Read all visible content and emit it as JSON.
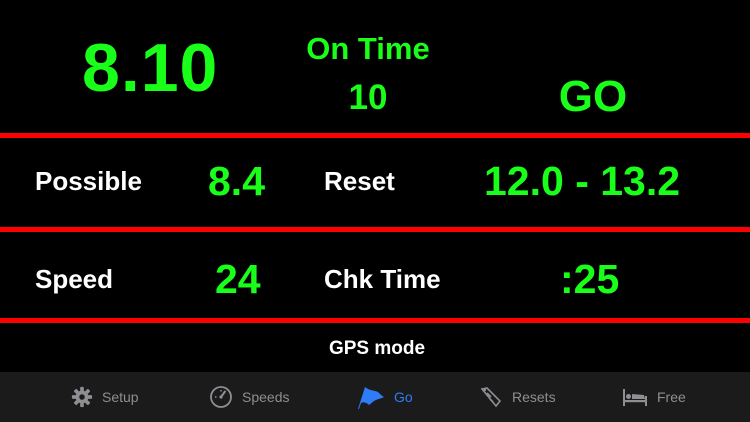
{
  "top": {
    "distance": "8.10",
    "on_time_label": "On Time",
    "on_time_value": "10",
    "status": "GO"
  },
  "rows": {
    "possible_label": "Possible",
    "possible_value": "8.4",
    "reset_label": "Reset",
    "reset_value": "12.0 - 13.2",
    "speed_label": "Speed",
    "speed_value": "24",
    "chk_time_label": "Chk Time",
    "chk_time_value": ":25"
  },
  "mode_text": "GPS mode",
  "tabs": [
    {
      "label": "Setup",
      "icon": "gear-icon",
      "active": false
    },
    {
      "label": "Speeds",
      "icon": "speedometer-icon",
      "active": false
    },
    {
      "label": "Go",
      "icon": "flag-icon",
      "active": true
    },
    {
      "label": "Resets",
      "icon": "resets-icon",
      "active": false
    },
    {
      "label": "Free",
      "icon": "bed-icon",
      "active": false
    }
  ],
  "colors": {
    "background": "#000000",
    "value_green": "#19ff19",
    "divider_red": "#ff0000",
    "tab_inactive": "#8e8e93",
    "tab_active": "#2f7cf6",
    "tabbar_bg": "#1b1b1b"
  }
}
